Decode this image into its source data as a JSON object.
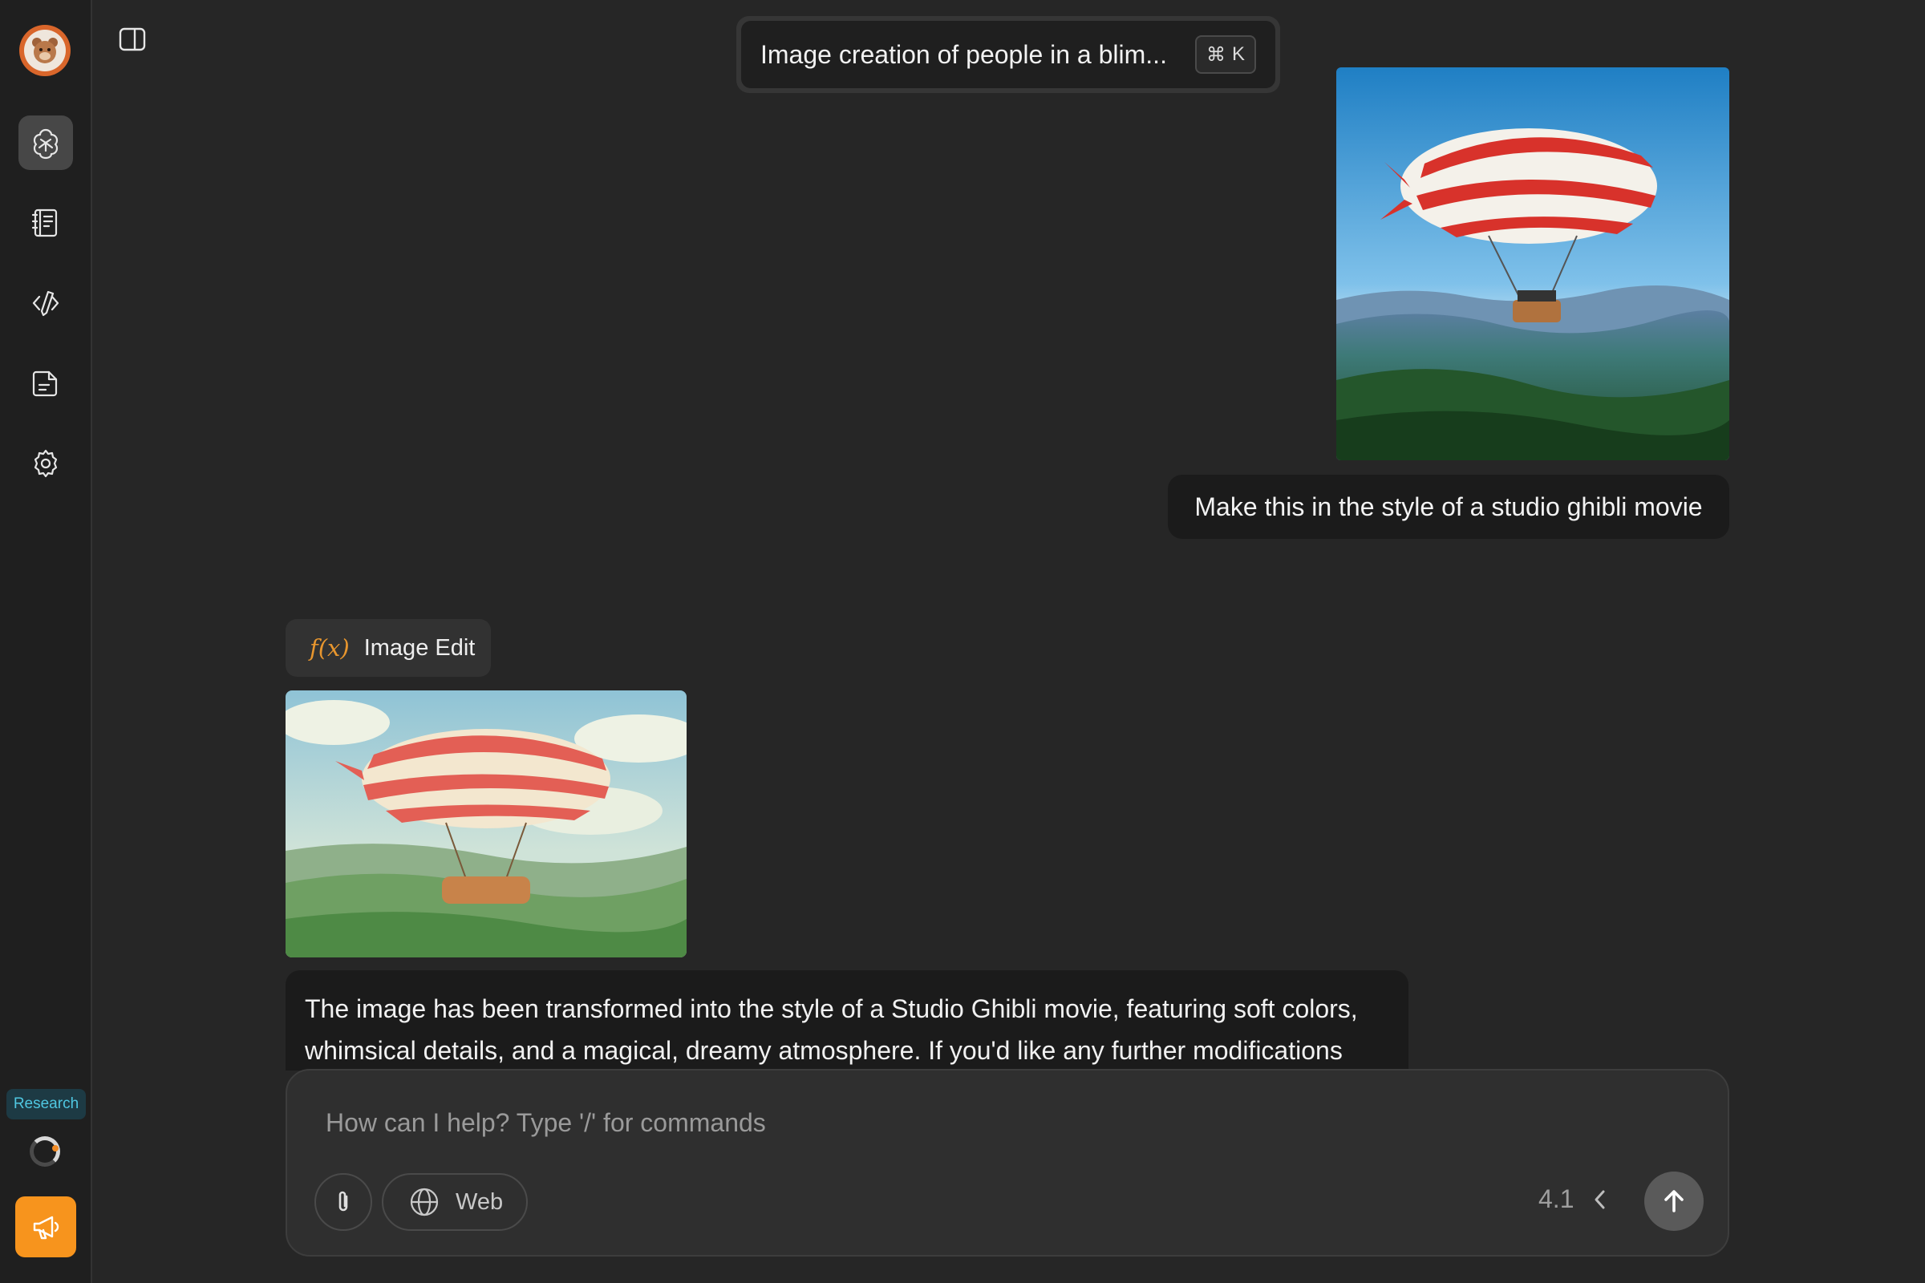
{
  "header": {
    "chat_title": "Image creation of people in a blim...",
    "shortcut_symbol": "⌘",
    "shortcut_key": "K"
  },
  "sidebar": {
    "items": [
      {
        "name": "ai-chat",
        "icon": "ai-brain-icon",
        "active": true
      },
      {
        "name": "notebook",
        "icon": "notebook-icon",
        "active": false
      },
      {
        "name": "code-editor",
        "icon": "code-pen-icon",
        "active": false
      },
      {
        "name": "document",
        "icon": "document-icon",
        "active": false
      },
      {
        "name": "settings",
        "icon": "gear-icon",
        "active": false
      }
    ],
    "research_label": "Research",
    "promo_icon": "megaphone-icon"
  },
  "conversation": {
    "user_message": "Make this in the style of a studio ghibli movie",
    "tool_label": "Image Edit",
    "tool_icon_text": "f(x)",
    "assistant_message": "The image has been transformed into the style of a Studio Ghibli movie, featuring soft colors, whimsical details, and a magical, dreamy atmosphere. If you'd like any further modifications"
  },
  "composer": {
    "placeholder": "How can I help? Type '/' for commands",
    "web_label": "Web",
    "model_version": "4.1"
  },
  "colors": {
    "background": "#262626",
    "sidebar": "#1f1f1f",
    "accent_orange": "#f7941d",
    "research_text": "#4fc6e0"
  }
}
